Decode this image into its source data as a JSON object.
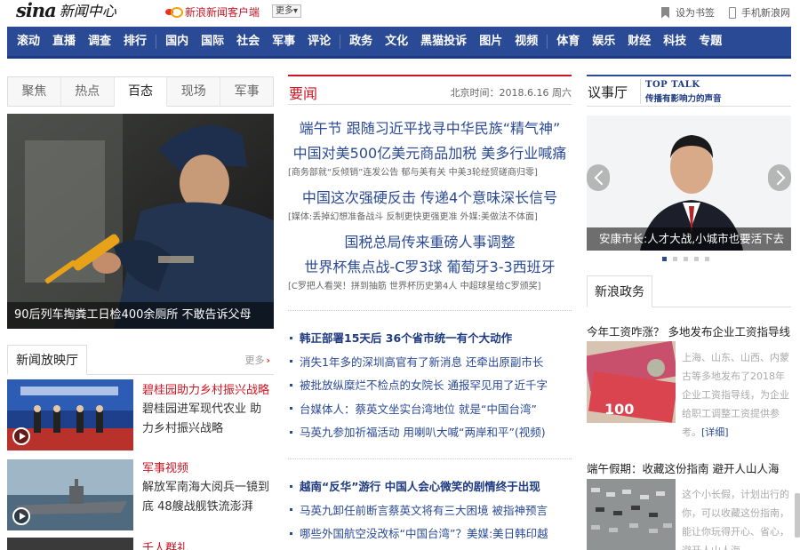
{
  "topbar": {
    "logo_text": "sina",
    "site_name": "新闻中心",
    "client_label": "新浪新闻客户端",
    "more_label": "更多",
    "bookmark_label": "设为书签",
    "mobile_label": "手机新浪网"
  },
  "nav": {
    "groups": [
      [
        "滚动",
        "直播",
        "调查",
        "排行"
      ],
      [
        "国内",
        "国际",
        "社会",
        "军事",
        "评论"
      ],
      [
        "政务",
        "文化",
        "黑猫投诉",
        "图片",
        "视频"
      ],
      [
        "体育",
        "娱乐",
        "财经",
        "科技",
        "专题"
      ]
    ]
  },
  "left": {
    "tabs": [
      "聚焦",
      "热点",
      "百态",
      "现场",
      "军事"
    ],
    "active_tab": "百态",
    "hero_caption": "90后列车掏粪工日检400余厕所 不敢告诉父母",
    "theater_title": "新闻放映厅",
    "theater_more": "更多",
    "videos": [
      {
        "title": "碧桂园助力乡村振兴战略",
        "desc": "碧桂园进军现代农业 助力乡村振兴战略"
      },
      {
        "title": "军事视频",
        "desc": "解放军南海大阅兵一镜到底 48艘战舰铁流澎湃"
      },
      {
        "title": "千人群礼",
        "desc": ""
      }
    ]
  },
  "middle": {
    "section_title": "要闻",
    "time_text": "北京时间：2018.6.16 周六",
    "headlines": [
      {
        "text": "端午节 跟随习近平找寻中华民族“精气神”"
      },
      {
        "text": "中国对美500亿美元商品加税 美多行业喊痛"
      },
      {
        "sub": "[商务部就“反倾销”连发公告 郁与美有关 中美3轮经贸磋商归零]"
      },
      {
        "text": "中国这次强硬反击 传递4个意味深长信号"
      },
      {
        "sub": "[媒体:丢掉幻想准备战斗 反制更快更强更准 外媒:美做法不体面]"
      },
      {
        "text": "国税总局传来重磅人事调整"
      },
      {
        "text": "世界杯焦点战-C罗3球 葡萄牙3-3西班牙"
      },
      {
        "sub": "[C罗把人看哭！拼到抽筋 世界杯历史第4人 中超球星给C罗颁奖]"
      }
    ],
    "list1": [
      {
        "text": "韩正部署15天后 36个省市统一有个大动作",
        "bold": true
      },
      {
        "text": "消失1年多的深圳高官有了新消息 还牵出原副市长",
        "bold": false
      },
      {
        "text": "被批放纵糜烂不检点的女院长 通报罕见用了近千字",
        "bold": false
      },
      {
        "text": "台媒体人：蔡英文坐实台湾地位 就是“中国台湾”",
        "bold": false
      },
      {
        "text": "马英九参加祈福活动 用喇叭大喊“两岸和平”(视频)",
        "bold": false
      }
    ],
    "list2": [
      {
        "text": "越南“反华”游行 中国人会心微笑的剧情终于出现",
        "bold": true
      },
      {
        "text": "马英九卸任前断言蔡英文将有三大困境 被指神预言",
        "bold": false
      },
      {
        "text": "哪些外国航空没改标“中国台湾”？美媒:美日韩印越",
        "bold": false
      }
    ]
  },
  "right": {
    "talk_title": "议事厅",
    "toptalk_en": "TOP TALK",
    "toptalk_cn": "传播有影响力的声音",
    "talk_caption": "安康市长:人才大战,小城市也要活下去",
    "carousel_total": 5,
    "carousel_active": 1,
    "gov_title": "新浪政务",
    "items": [
      {
        "title": "今年工资咋涨？ 多地发布企业工资指导线",
        "desc": "上海、山东、山西、内蒙古等多地发布了2018年企业工资指导线，为企业给职工调整工资提供参考。",
        "detail": "[详细]"
      },
      {
        "title": "端午假期：收藏这份指南 避开人山人海",
        "desc": "这个小长假，计划出行的你，可以收藏这份指南，能让你玩得开心、省心，避开人山人海",
        "detail": ""
      }
    ]
  }
}
